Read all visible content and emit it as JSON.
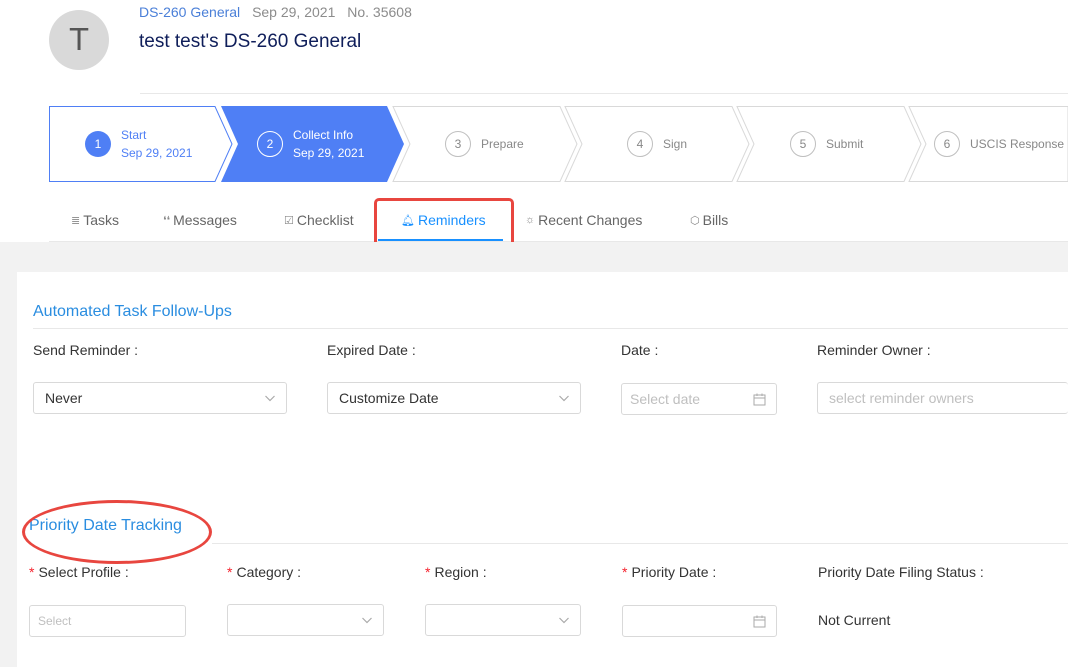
{
  "header": {
    "avatar_letter": "T",
    "form_link": "DS-260 General",
    "date": "Sep 29, 2021",
    "case_no": "No. 35608",
    "title": "test test's DS-260 General"
  },
  "steps": [
    {
      "num": "1",
      "label": "Start",
      "date": "Sep 29, 2021",
      "state": "done"
    },
    {
      "num": "2",
      "label": "Collect Info",
      "date": "Sep 29, 2021",
      "state": "current"
    },
    {
      "num": "3",
      "label": "Prepare",
      "state": "pending"
    },
    {
      "num": "4",
      "label": "Sign",
      "state": "pending"
    },
    {
      "num": "5",
      "label": "Submit",
      "state": "pending"
    },
    {
      "num": "6",
      "label": "USCIS Response",
      "state": "pending"
    }
  ],
  "tabs": {
    "tasks": "Tasks",
    "messages": "Messages",
    "checklist": "Checklist",
    "reminders": "Reminders",
    "recent_changes": "Recent Changes",
    "bills": "Bills",
    "active": "reminders"
  },
  "followups": {
    "title": "Automated Task Follow-Ups",
    "send_reminder_label": "Send Reminder",
    "send_reminder_value": "Never",
    "expired_date_label": "Expired Date",
    "expired_date_value": "Customize Date",
    "date_label": "Date",
    "date_placeholder": "Select date",
    "owner_label": "Reminder Owner",
    "owner_placeholder": "select reminder owners"
  },
  "priority": {
    "title": "Priority Date Tracking",
    "profile_label": "Select Profile",
    "profile_placeholder": "Select",
    "category_label": "Category",
    "region_label": "Region",
    "priority_date_label": "Priority Date",
    "filing_status_label": "Priority Date Filing Status",
    "filing_status_value": "Not Current"
  },
  "colors": {
    "accent": "#1890ff",
    "step_active": "#4f7ff5",
    "annotation": "#e8463f"
  }
}
